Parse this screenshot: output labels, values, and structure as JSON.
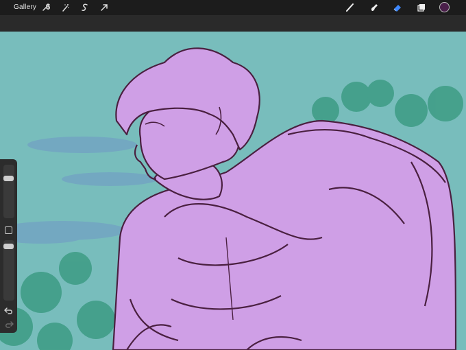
{
  "toolbar": {
    "gallery_label": "Gallery",
    "left_tools": [
      "actions-icon",
      "adjustments-icon",
      "selection-icon",
      "transform-icon"
    ],
    "right_tools": [
      "brush-icon",
      "smudge-icon",
      "eraser-icon",
      "layers-icon"
    ],
    "active_tool": "eraser-icon",
    "current_color": "#4a1f4a"
  },
  "canvas": {
    "background_color": "#78bdbc",
    "figure_color": "#cf9fe6",
    "line_color": "#4a2040",
    "foliage_color": "#3d9c84"
  },
  "sidebar": {
    "controls": [
      "brush-size-slider",
      "modify-button",
      "opacity-slider",
      "undo-button",
      "redo-button"
    ]
  }
}
